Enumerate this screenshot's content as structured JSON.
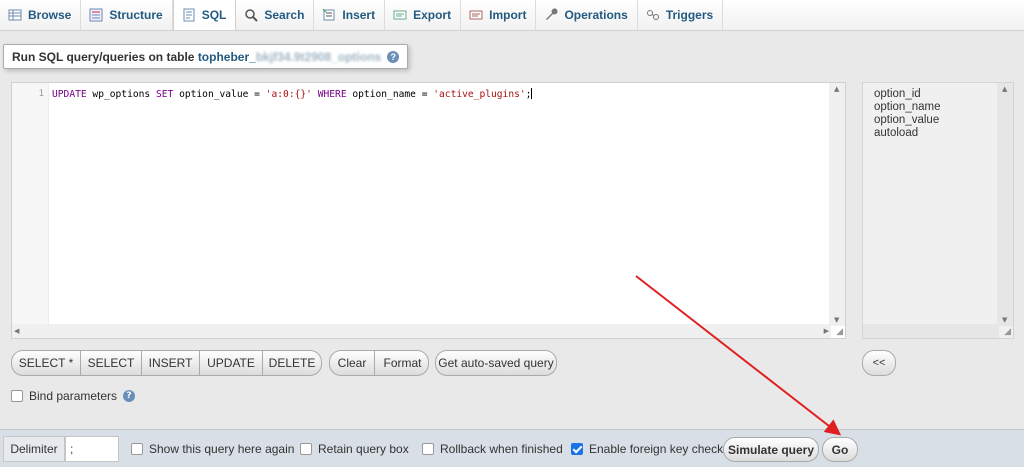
{
  "tabs": [
    {
      "label": "Browse",
      "icon": "browse-icon"
    },
    {
      "label": "Structure",
      "icon": "structure-icon"
    },
    {
      "label": "SQL",
      "icon": "sql-icon",
      "active": true
    },
    {
      "label": "Search",
      "icon": "search-icon"
    },
    {
      "label": "Insert",
      "icon": "insert-icon"
    },
    {
      "label": "Export",
      "icon": "export-icon"
    },
    {
      "label": "Import",
      "icon": "import-icon"
    },
    {
      "label": "Operations",
      "icon": "wrench-icon"
    },
    {
      "label": "Triggers",
      "icon": "triggers-icon"
    }
  ],
  "legend": {
    "prefix": "Run SQL query/queries on table ",
    "table_visible": "topheber_",
    "table_blurred": "bkjf34.9t2908_options"
  },
  "editor": {
    "line_number": "1",
    "query": {
      "t1": "UPDATE",
      "t2": " wp_options ",
      "t3": "SET",
      "t4": " option_value = ",
      "t5": "'a:0:{}'",
      "t6": " ",
      "t7": "WHERE",
      "t8": " option_name = ",
      "t9": "'active_plugins'",
      "t10": ";"
    }
  },
  "columns": [
    "option_id",
    "option_name",
    "option_value",
    "autoload"
  ],
  "insert_buttons": [
    "SELECT *",
    "SELECT",
    "INSERT",
    "UPDATE",
    "DELETE"
  ],
  "edit_buttons": [
    "Clear",
    "Format"
  ],
  "autosave_button": "Get auto-saved query",
  "insert_column_button": "<<",
  "bind_parameters": "Bind parameters",
  "footer": {
    "delimiter_label": "Delimiter",
    "delimiter_value": ";",
    "show_query": "Show this query here again",
    "retain_box": "Retain query box",
    "rollback": "Rollback when finished",
    "foreign_keys": "Enable foreign key checks",
    "simulate": "Simulate query",
    "go": "Go"
  },
  "colors": {
    "keyword": "#770088",
    "string": "#aa1111",
    "tab_text": "#235a81",
    "annotation_arrow": "#e02020"
  }
}
